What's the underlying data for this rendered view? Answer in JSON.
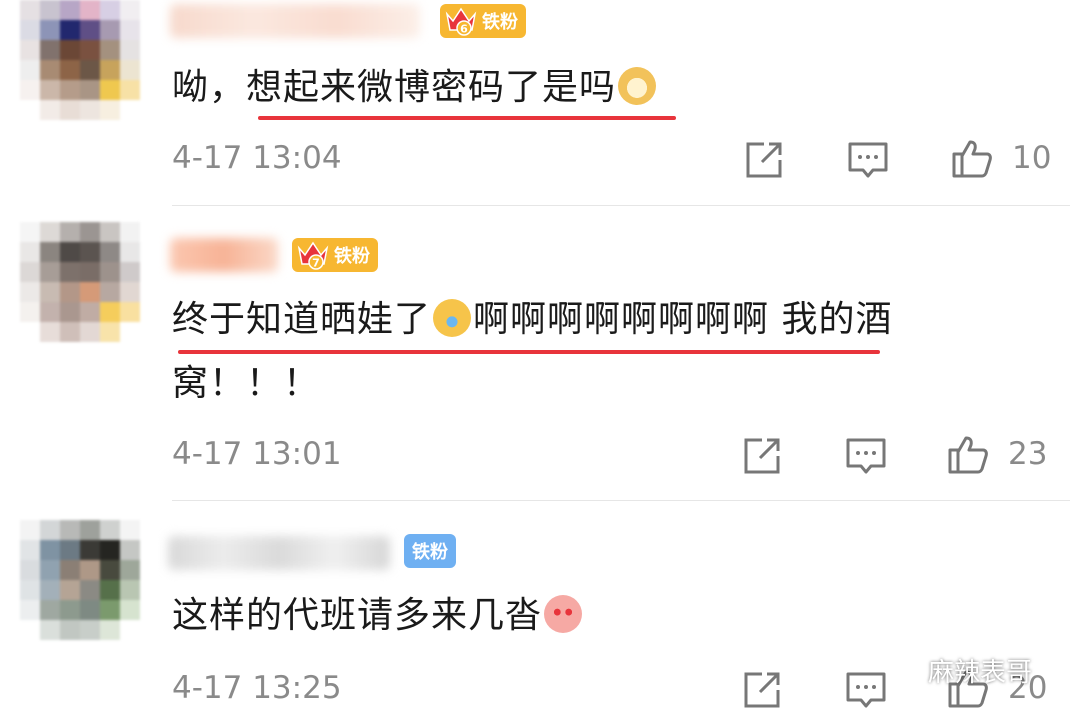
{
  "comments": [
    {
      "badge": "铁粉",
      "badge_level": "6",
      "text_before": "呦，想起来微博密码了是吗",
      "emoji": "dog-face-emoji",
      "text_after": "",
      "time": "4-17 13:04",
      "likes": "10"
    },
    {
      "badge": "铁粉",
      "badge_level": "7",
      "text_before": "终于知道晒娃了",
      "emoji": "crying-emoji",
      "text_after": "啊啊啊啊啊啊啊啊 我的酒",
      "text_line2": "窝！！！",
      "time": "4-17 13:01",
      "likes": "23"
    },
    {
      "badge": "铁粉",
      "text_before": "这样的代班请多来几沓",
      "emoji": "love-face-emoji",
      "time": "4-17 13:25",
      "likes": "20"
    }
  ],
  "watermark": "麻辣表哥",
  "colors": {
    "underline": "#e8343b",
    "badge_gold": "#f7b731",
    "badge_blue": "#6fb0f2",
    "meta_gray": "#8a8a8a"
  }
}
